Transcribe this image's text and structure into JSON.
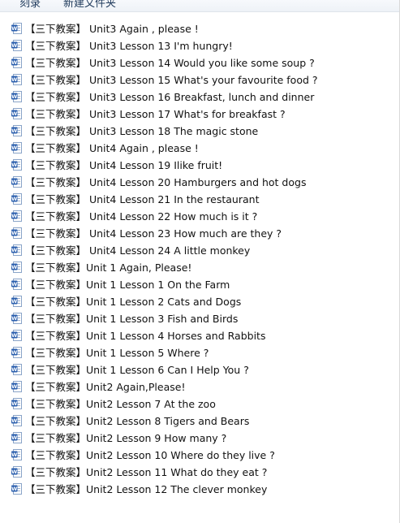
{
  "toolbar": {
    "burn_label": "刻录",
    "new_folder_label": "新建文件夹"
  },
  "icons": {
    "file": "word-document-icon"
  },
  "colors": {
    "icon_blue": "#2b5fae",
    "selection": "#e5f3ff"
  },
  "files": [
    "【三下教案】 Unit3 Again , please !",
    "【三下教案】 Unit3 Lesson 13 I'm hungry!",
    "【三下教案】 Unit3 Lesson 14 Would you like some soup ?",
    "【三下教案】 Unit3 Lesson 15 What's your favourite food ?",
    "【三下教案】 Unit3 Lesson 16 Breakfast, lunch and dinner",
    "【三下教案】 Unit3 Lesson 17 What's for breakfast ?",
    "【三下教案】 Unit3 Lesson 18 The magic stone",
    "【三下教案】 Unit4 Again , please !",
    "【三下教案】 Unit4 Lesson 19 Ilike fruit!",
    "【三下教案】 Unit4 Lesson 20 Hamburgers and hot dogs",
    "【三下教案】 Unit4 Lesson 21 In the restaurant",
    "【三下教案】 Unit4 Lesson 22 How much is it ?",
    "【三下教案】 Unit4 Lesson 23 How much are they ?",
    "【三下教案】 Unit4 Lesson 24 A little monkey",
    "【三下教案】Unit 1 Again, Please!",
    "【三下教案】Unit 1 Lesson 1 On the Farm",
    "【三下教案】Unit 1 Lesson 2 Cats and Dogs",
    "【三下教案】Unit 1 Lesson 3 Fish and Birds",
    "【三下教案】Unit 1 Lesson 4 Horses and Rabbits",
    "【三下教案】Unit 1 Lesson 5 Where ?",
    "【三下教案】Unit 1 Lesson 6 Can I Help You ?",
    "【三下教案】Unit2 Again,Please!",
    "【三下教案】Unit2 Lesson 7 At the zoo",
    "【三下教案】Unit2 Lesson 8 Tigers and Bears",
    "【三下教案】Unit2 Lesson 9 How many ?",
    "【三下教案】Unit2 Lesson 10 Where do they live ?",
    "【三下教案】Unit2 Lesson 11 What do they eat ?",
    "【三下教案】Unit2 Lesson 12 The clever monkey"
  ]
}
